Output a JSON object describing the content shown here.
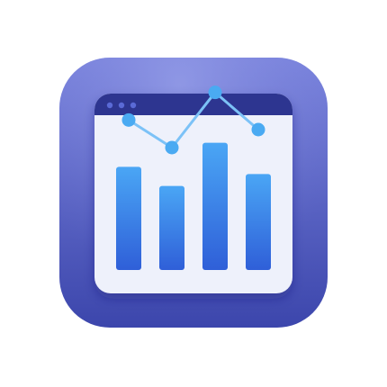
{
  "app_icon": {
    "icon_name": "analytics-chart-icon",
    "colors": {
      "tile_light": "#7f88e0",
      "tile_dark": "#3f49b0",
      "titlebar": "#2d3590",
      "window_dots": "#5a6ad6",
      "window_body": "#eef1fb",
      "bar_top": "#4aa6f5",
      "bar_bottom": "#2f5fd8",
      "line": "#7cc2f7",
      "line_point": "#4aaaf2"
    },
    "chart_data": {
      "type": "bar",
      "categories": [
        "",
        "",
        "",
        ""
      ],
      "values": [
        86,
        70,
        106,
        80
      ],
      "ylim": [
        0,
        120
      ],
      "overlay_line": [
        125,
        102,
        148,
        117
      ]
    }
  }
}
